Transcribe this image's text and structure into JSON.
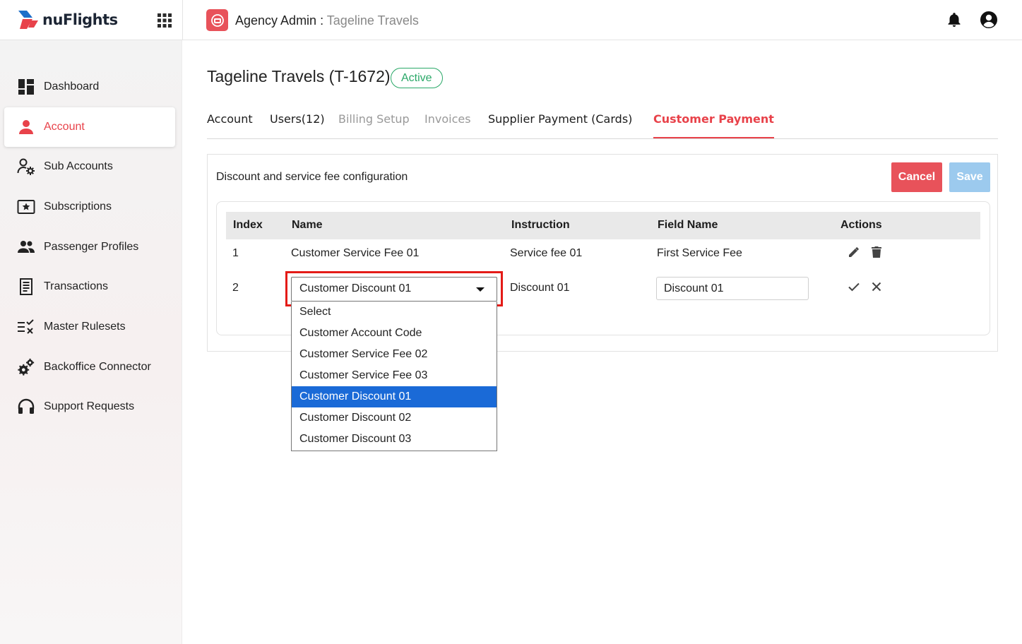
{
  "header": {
    "brand": "nuFlights",
    "role": "Agency Admin",
    "separator": ":",
    "agency": "Tageline Travels",
    "icons": [
      "apps-grid-icon",
      "agency-icon",
      "bell-icon",
      "user-circle-icon"
    ]
  },
  "sidebar": {
    "items": [
      {
        "label": "Dashboard",
        "icon": "dashboard-icon"
      },
      {
        "label": "Account",
        "icon": "person-icon",
        "active": true
      },
      {
        "label": "Sub Accounts",
        "icon": "sub-accounts-icon"
      },
      {
        "label": "Subscriptions",
        "icon": "subscriptions-icon"
      },
      {
        "label": "Passenger Profiles",
        "icon": "people-icon"
      },
      {
        "label": "Transactions",
        "icon": "receipt-icon"
      },
      {
        "label": "Master Rulesets",
        "icon": "rules-icon"
      },
      {
        "label": "Backoffice Connector",
        "icon": "gears-icon"
      },
      {
        "label": "Support Requests",
        "icon": "headset-icon"
      }
    ]
  },
  "page": {
    "title": "Tageline Travels (T-1672)",
    "status": "Active"
  },
  "tabs": [
    {
      "label": "Account"
    },
    {
      "label": "Users(12)"
    },
    {
      "label": "Billing Setup"
    },
    {
      "label": "Invoices"
    },
    {
      "label": "Supplier Payment (Cards)"
    },
    {
      "label": "Customer Payment",
      "selected": true
    }
  ],
  "card": {
    "heading": "Discount and service fee configuration",
    "cancel_label": "Cancel",
    "save_label": "Save"
  },
  "table": {
    "columns": [
      "Index",
      "Name",
      "Instruction",
      "Field Name",
      "Actions"
    ],
    "rows": [
      {
        "index": "1",
        "name": "Customer Service Fee 01",
        "instruction": "Service fee 01",
        "field_name": "First Service Fee"
      },
      {
        "index": "2",
        "name": "Customer Discount 01",
        "instruction": "Discount  01",
        "field_name": "Discount 01"
      }
    ]
  },
  "dropdown": {
    "selected": "Customer Discount 01",
    "options": [
      "Select",
      "Customer Account Code",
      "Customer Service Fee 02",
      "Customer Service Fee 03",
      "Customer Discount 01",
      "Customer Discount 02",
      "Customer Discount 03"
    ]
  },
  "colors": {
    "accent": "#e8424a",
    "active_badge": "#2aa868",
    "save_disabled": "#9ccaee",
    "option_highlight": "#1a6ad7",
    "annotation_frame": "#e41b17"
  }
}
